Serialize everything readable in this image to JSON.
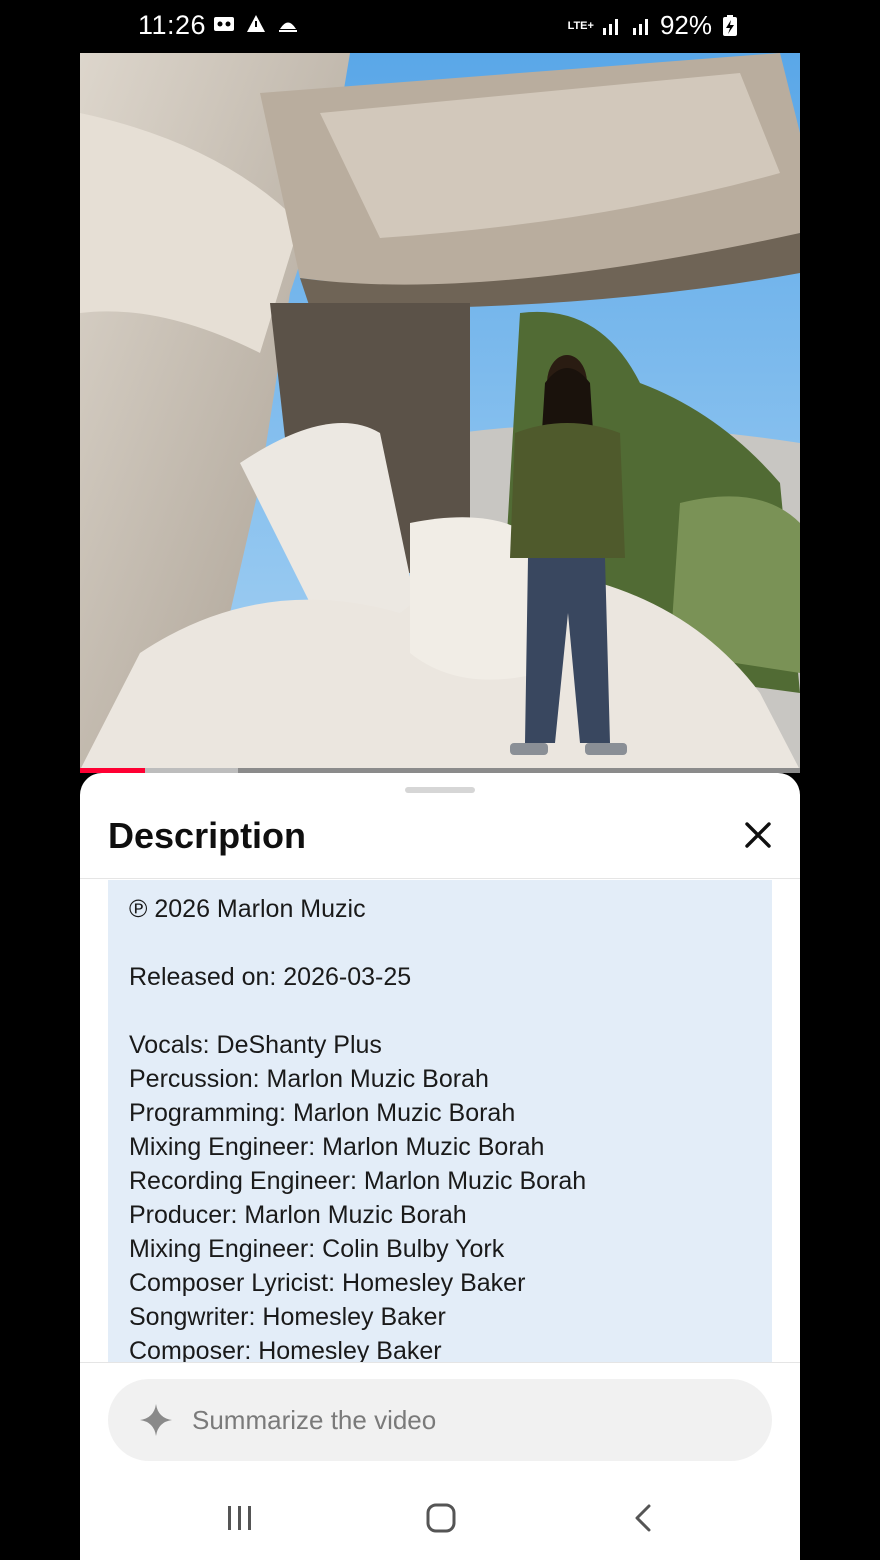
{
  "status_bar": {
    "time": "11:26",
    "network": "LTE+",
    "battery": "92%"
  },
  "player": {
    "progress": 0.09,
    "buffered": 0.22
  },
  "sheet": {
    "title": "Description",
    "close_icon": "close-icon",
    "description_lines": [
      "℗ 2026 Marlon Muzic",
      "",
      "Released on: 2026-03-25",
      "",
      "Vocals: DeShanty Plus",
      "Percussion: Marlon Muzic Borah",
      "Programming: Marlon Muzic Borah",
      "Mixing Engineer: Marlon Muzic Borah",
      "Recording Engineer: Marlon Muzic Borah",
      "Producer: Marlon Muzic Borah",
      "Mixing Engineer: Colin Bulby York",
      "Composer Lyricist: Homesley Baker",
      "Songwriter: Homesley Baker",
      "Composer: Homesley Baker"
    ],
    "summarize_label": "Summarize the video"
  },
  "colors": {
    "accent": "#ff0033",
    "panel": "#e3edf8"
  }
}
